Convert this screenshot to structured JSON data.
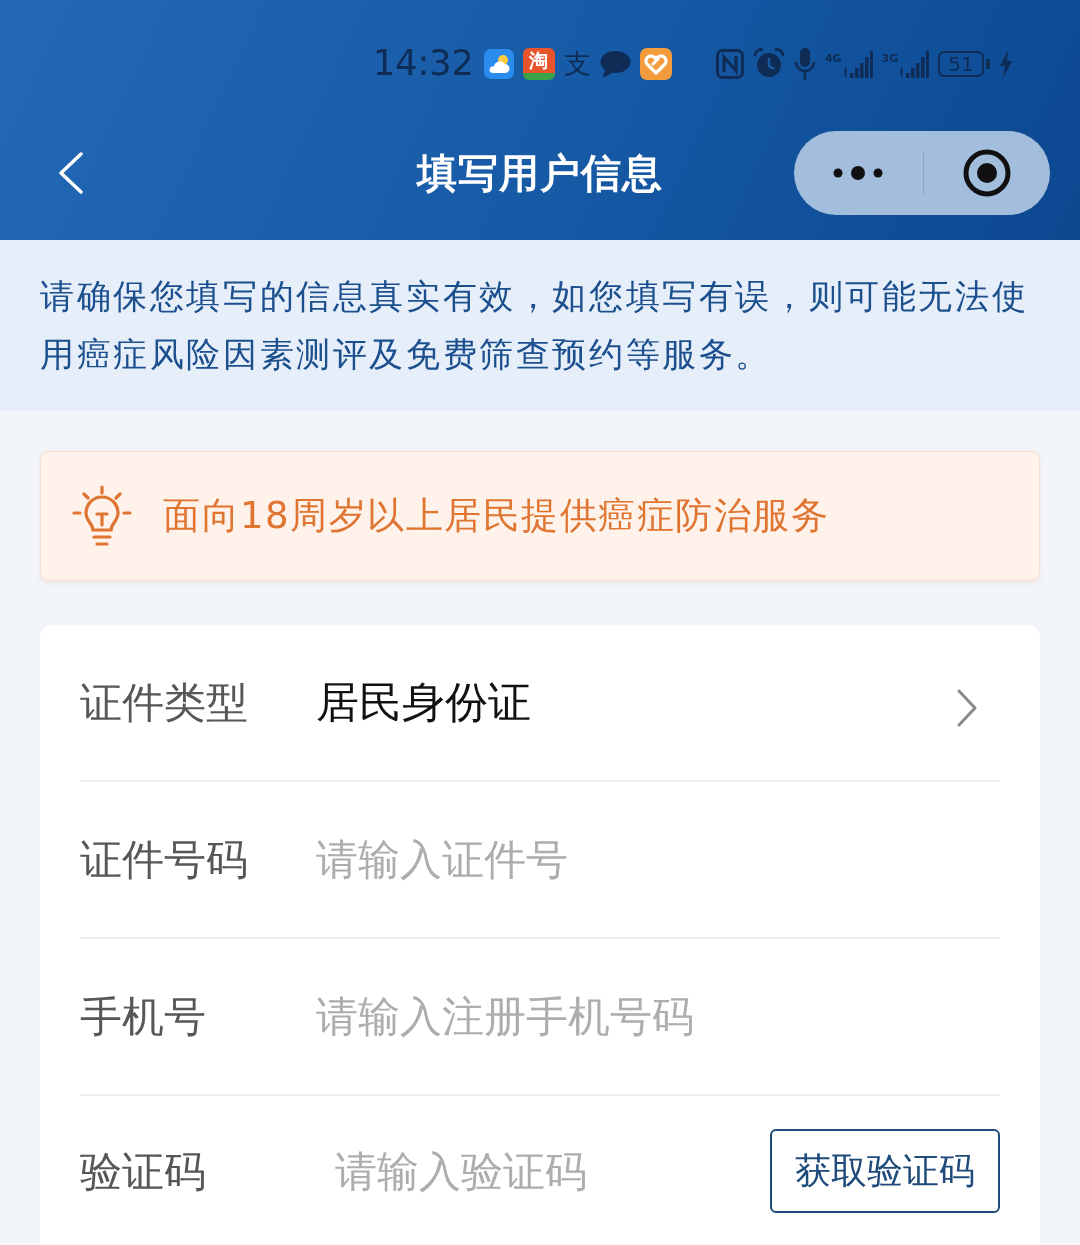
{
  "status_bar": {
    "time": "14:32",
    "app_icons": [
      {
        "kind": "weather"
      },
      {
        "kind": "tile",
        "glyph": "淘"
      },
      {
        "kind": "glyph",
        "glyph": "支"
      },
      {
        "kind": "chat"
      },
      {
        "kind": "heart"
      }
    ],
    "system_icons": [
      {
        "kind": "nfc"
      },
      {
        "kind": "alarm"
      },
      {
        "kind": "mic"
      },
      {
        "kind": "signal",
        "label": "4G"
      },
      {
        "kind": "signal",
        "label": "3G"
      }
    ],
    "battery": "51",
    "charging": true
  },
  "nav_bar": {
    "title": "填写用户信息"
  },
  "notice": "请确保您填写的信息真实有效，如您填写有误，则可能无法使用癌症风险因素测评及免费筛查预约等服务。",
  "tip": "面向18周岁以上居民提供癌症防治服务",
  "form": {
    "fields": [
      {
        "kind": "select",
        "label": "证件类型",
        "value": "居民身份证"
      },
      {
        "kind": "input",
        "label": "证件号码",
        "placeholder": "请输入证件号"
      },
      {
        "kind": "input",
        "label": "手机号",
        "placeholder": "请输入注册手机号码"
      },
      {
        "kind": "code",
        "label": "验证码",
        "placeholder": "请输入验证码",
        "button": "获取验证码"
      }
    ]
  }
}
